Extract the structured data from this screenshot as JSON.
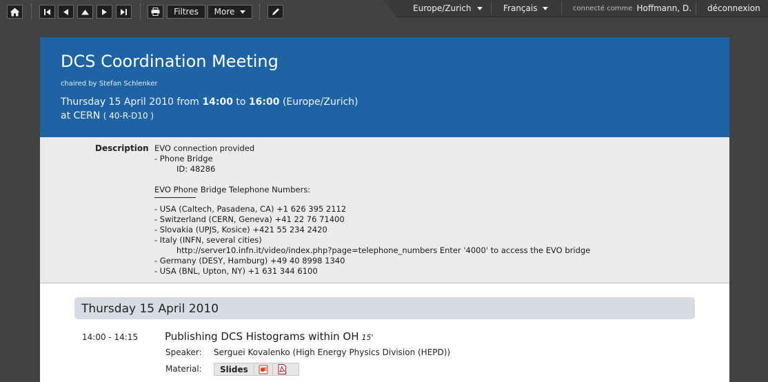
{
  "toolbar": {
    "filter_label": "Filtres",
    "more_label": "More"
  },
  "session": {
    "timezone": "Europe/Zurich",
    "language": "Français",
    "logged_in_prefix": "connecté comme",
    "user": "Hoffmann, D.",
    "logout": "déconnexion"
  },
  "event": {
    "title": "DCS Coordination Meeting",
    "chaired": "chaired by Stefan Schlenker",
    "date_text": "Thursday 15 April 2010 from",
    "start": "14:00",
    "to": "to",
    "end": "16:00",
    "tz": "(Europe/Zurich)",
    "at": "at CERN",
    "room": "( 40-R-D10 )"
  },
  "description": {
    "label": "Description",
    "lines_a": [
      "EVO connection provided",
      "- Phone Bridge"
    ],
    "id_line": "ID: 48286",
    "blank": "",
    "heading": "EVO Phone Bridge Telephone Numbers:",
    "lines_b": [
      "- USA (Caltech, Pasadena, CA) +1 626 395 2112",
      "- Switzerland (CERN, Geneva) +41 22 76 71400",
      "- Slovakia (UPJS, Kosice) +421 55 234 2420",
      "- Italy (INFN, several cities)"
    ],
    "url_line": "http://server10.infn.it/video/index.php?page=telephone_numbers Enter '4000' to access the EVO bridge",
    "lines_c": [
      "- Germany (DESY, Hamburg) +49 40 8998 1340",
      "- USA (BNL, Upton, NY) +1 631 344 6100"
    ]
  },
  "day": {
    "title": "Thursday 15 April 2010"
  },
  "contribution": {
    "time": "14:00 - 14:15",
    "title": "Publishing DCS Histograms within OH",
    "duration": "15'",
    "speaker_label": "Speaker:",
    "speaker": "Serguei Kovalenko (High Energy Physics Division (HEPD))",
    "material_label": "Material:",
    "slides_label": "Slides"
  },
  "colors": {
    "header_bg": "#1e64a4",
    "page_bg": "#424242",
    "day_bar": "#d7dce4"
  }
}
